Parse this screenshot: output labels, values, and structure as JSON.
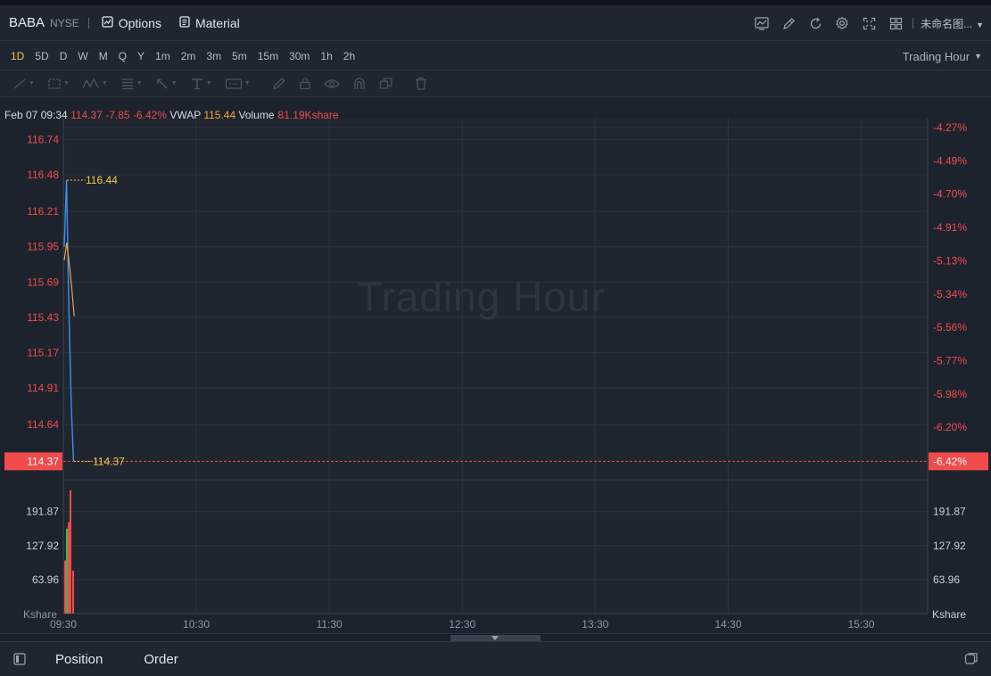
{
  "header": {
    "symbol": "BABA",
    "exchange": "NYSE",
    "options_label": "Options",
    "material_label": "Material",
    "layout_name": "未命名图..."
  },
  "periods": [
    "1D",
    "5D",
    "D",
    "W",
    "M",
    "Q",
    "Y",
    "1m",
    "2m",
    "3m",
    "5m",
    "15m",
    "30m",
    "1h",
    "2h"
  ],
  "active_period": "1D",
  "session_selector": "Trading Hour",
  "info": {
    "datetime": "Feb 07 09:34",
    "price": "114.37",
    "change": "-7.85",
    "change_pct": "-6.42%",
    "vwap_label": "VWAP",
    "vwap": "115.44",
    "volume_label": "Volume",
    "volume": "81.19Kshare"
  },
  "watermark": "Trading Hour",
  "bottom_tabs": [
    "Position",
    "Order"
  ],
  "colors": {
    "up": "#f24b4b",
    "down": "#3fb950",
    "price_line": "#3d8ef0",
    "vwap_line": "#f2a33b",
    "marker": "#f5c842"
  },
  "chart_data": {
    "type": "line",
    "price_axis_labels": [
      "116.74",
      "116.48",
      "116.21",
      "115.95",
      "115.69",
      "115.43",
      "115.17",
      "114.91",
      "114.64"
    ],
    "percent_axis_labels": [
      "-4.27%",
      "-4.49%",
      "-4.70%",
      "-4.91%",
      "-5.13%",
      "-5.34%",
      "-5.56%",
      "-5.77%",
      "-5.98%",
      "-6.20%"
    ],
    "current_price_label": "114.37",
    "current_percent_label": "-6.42%",
    "high_marker": "116.44",
    "last_marker": "114.37",
    "time_labels": [
      "09:30",
      "10:30",
      "11:30",
      "12:30",
      "13:30",
      "14:30",
      "15:30"
    ],
    "price_ylim": [
      114.3,
      116.9
    ],
    "price_series": {
      "name": "",
      "x": [
        "09:30",
        "09:31",
        "09:32",
        "09:33",
        "09:34"
      ],
      "values": [
        115.95,
        116.44,
        115.5,
        114.8,
        114.37
      ]
    },
    "vwap_series": {
      "name": "VWAP",
      "x": [
        "09:30",
        "09:31",
        "09:32",
        "09:33",
        "09:34"
      ],
      "values": [
        115.85,
        115.98,
        115.83,
        115.65,
        115.44
      ]
    },
    "volume_axis": {
      "labels_left": [
        "191.87",
        "127.92",
        "63.96"
      ],
      "labels_right": [
        "191.87",
        "127.92",
        "63.96"
      ],
      "unit": "Kshare",
      "ylim": [
        0,
        235
      ]
    },
    "volume_bars": [
      {
        "x": "09:30",
        "value": 100,
        "dir": "up"
      },
      {
        "x": "09:30",
        "value": 160,
        "dir": "down"
      },
      {
        "x": "09:31",
        "value": 172,
        "dir": "up"
      },
      {
        "x": "09:31",
        "value": 232,
        "dir": "up"
      },
      {
        "x": "09:32",
        "value": 81,
        "dir": "up"
      }
    ],
    "grid": true
  }
}
